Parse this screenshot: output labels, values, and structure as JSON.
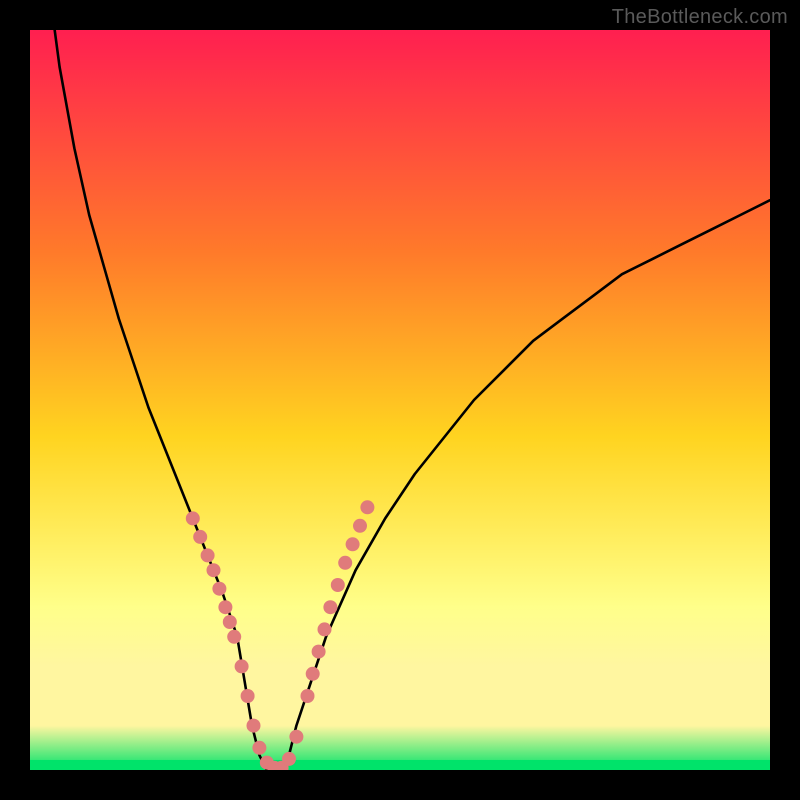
{
  "watermark": "TheBottleneck.com",
  "colors": {
    "frame": "#000000",
    "gradient_top": "#ff1f50",
    "gradient_mid1": "#ff7a2a",
    "gradient_mid2": "#ffd420",
    "gradient_mid3": "#ffff8a",
    "gradient_bottom_band": "#fff6a0",
    "gradient_green": "#00e36a",
    "curve": "#000000",
    "markers": "#e07b7b"
  },
  "chart_data": {
    "type": "line",
    "title": "",
    "xlabel": "",
    "ylabel": "",
    "xlim": [
      0,
      100
    ],
    "ylim": [
      0,
      100
    ],
    "grid": false,
    "legend": false,
    "curve_comment": "V-shaped bottleneck curve; y is qualitative (0=green/best near bottom, 100=red/worst near top). Values estimated from pixels.",
    "x": [
      0,
      2,
      4,
      6,
      8,
      10,
      12,
      14,
      16,
      18,
      20,
      22,
      24,
      26,
      28,
      29,
      30,
      31,
      32,
      33,
      34,
      35,
      36,
      38,
      40,
      44,
      48,
      52,
      56,
      60,
      64,
      68,
      72,
      76,
      80,
      84,
      88,
      92,
      96,
      100
    ],
    "y": [
      140,
      110,
      95,
      84,
      75,
      68,
      61,
      55,
      49,
      44,
      39,
      34,
      29,
      24,
      18,
      12,
      6,
      2,
      0,
      0,
      0,
      2,
      6,
      12,
      18,
      27,
      34,
      40,
      45,
      50,
      54,
      58,
      61,
      64,
      67,
      69,
      71,
      73,
      75,
      77
    ],
    "markers_comment": "Highlighted segments along the curve near the valley (salmon dots).",
    "markers": [
      {
        "x": 22.0,
        "y": 34.0
      },
      {
        "x": 23.0,
        "y": 31.5
      },
      {
        "x": 24.0,
        "y": 29.0
      },
      {
        "x": 24.8,
        "y": 27.0
      },
      {
        "x": 25.6,
        "y": 24.5
      },
      {
        "x": 26.4,
        "y": 22.0
      },
      {
        "x": 27.0,
        "y": 20.0
      },
      {
        "x": 27.6,
        "y": 18.0
      },
      {
        "x": 28.6,
        "y": 14.0
      },
      {
        "x": 29.4,
        "y": 10.0
      },
      {
        "x": 30.2,
        "y": 6.0
      },
      {
        "x": 31.0,
        "y": 3.0
      },
      {
        "x": 32.0,
        "y": 1.0
      },
      {
        "x": 33.0,
        "y": 0.3
      },
      {
        "x": 34.0,
        "y": 0.3
      },
      {
        "x": 35.0,
        "y": 1.5
      },
      {
        "x": 36.0,
        "y": 4.5
      },
      {
        "x": 37.5,
        "y": 10.0
      },
      {
        "x": 38.2,
        "y": 13.0
      },
      {
        "x": 39.0,
        "y": 16.0
      },
      {
        "x": 39.8,
        "y": 19.0
      },
      {
        "x": 40.6,
        "y": 22.0
      },
      {
        "x": 41.6,
        "y": 25.0
      },
      {
        "x": 42.6,
        "y": 28.0
      },
      {
        "x": 43.6,
        "y": 30.5
      },
      {
        "x": 44.6,
        "y": 33.0
      },
      {
        "x": 45.6,
        "y": 35.5
      }
    ]
  }
}
